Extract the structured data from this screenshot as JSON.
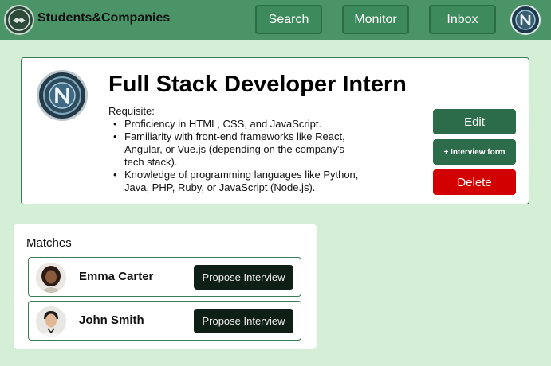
{
  "header": {
    "brand": "Students&Companies",
    "nav": [
      {
        "label": "Search"
      },
      {
        "label": "Monitor"
      },
      {
        "label": "Inbox"
      }
    ],
    "brand_color": "#4a9468"
  },
  "job": {
    "title": "Full Stack Developer Intern",
    "requisite_label": "Requisite:",
    "requirements": [
      "Proficiency in HTML, CSS, and JavaScript.",
      "Familiarity with front-end frameworks like React, Angular, or Vue.js (depending on the company's tech stack).",
      "Knowledge of programming languages like Python, Java, PHP, Ruby, or JavaScript (Node.js)."
    ],
    "actions": {
      "edit": "Edit",
      "interview_form": "+ Interview form",
      "delete": "Delete"
    },
    "delete_color": "#d30000"
  },
  "matches": {
    "title": "Matches",
    "items": [
      {
        "name": "Emma Carter",
        "action": "Propose Interview"
      },
      {
        "name": "John Smith",
        "action": "Propose Interview"
      }
    ]
  }
}
